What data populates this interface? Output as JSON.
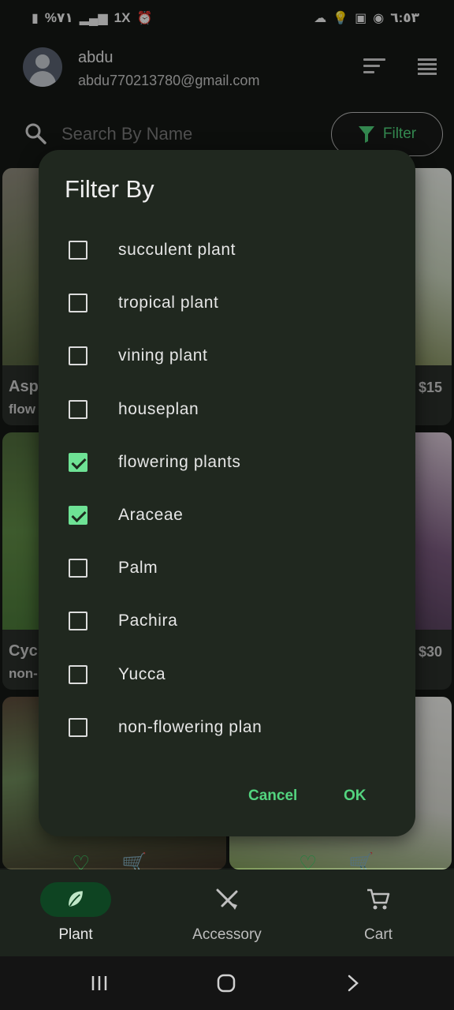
{
  "status_bar": {
    "battery": "%٧١",
    "signal": "1X",
    "time": "٦:٥٣"
  },
  "header": {
    "user_name": "abdu",
    "user_email": "abdu770213780@gmail.com"
  },
  "search": {
    "placeholder": "Search By Name",
    "filter_label": "Filter"
  },
  "products": [
    {
      "name_partial": "Asp",
      "sub_partial": "flow",
      "price": "$15"
    },
    {
      "name_partial": "Cyc",
      "sub_partial": "non-",
      "price": "$30"
    }
  ],
  "dialog": {
    "title": "Filter By",
    "options": [
      {
        "label": "succulent plant",
        "checked": false
      },
      {
        "label": "tropical plant",
        "checked": false
      },
      {
        "label": "vining plant",
        "checked": false
      },
      {
        "label": "houseplan",
        "checked": false
      },
      {
        "label": "flowering plants",
        "checked": true
      },
      {
        "label": "Araceae",
        "checked": true
      },
      {
        "label": "Palm",
        "checked": false
      },
      {
        "label": "Pachira",
        "checked": false
      },
      {
        "label": "Yucca",
        "checked": false
      },
      {
        "label": "non-flowering plan",
        "checked": false
      }
    ],
    "cancel_label": "Cancel",
    "ok_label": "OK"
  },
  "bottom_nav": {
    "items": [
      {
        "label": "Plant",
        "icon": "leaf-icon",
        "active": true
      },
      {
        "label": "Accessory",
        "icon": "garden-tools-icon",
        "active": false
      },
      {
        "label": "Cart",
        "icon": "cart-icon",
        "active": false
      }
    ]
  },
  "colors": {
    "accent": "#4fd07a",
    "dialog_bg": "#20281f",
    "checked": "#6ee295"
  }
}
